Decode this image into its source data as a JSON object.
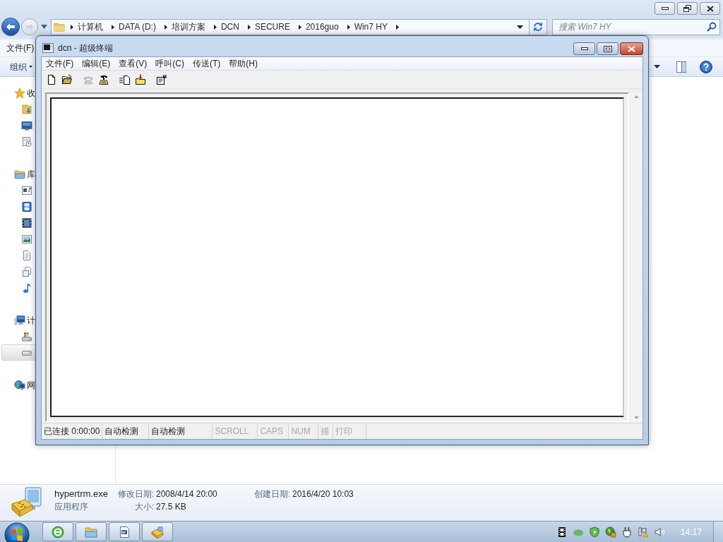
{
  "explorer": {
    "breadcrumbs": [
      "计算机",
      "DATA (D:)",
      "培训方案",
      "DCN",
      "SECURE",
      "2016guo",
      "Win7 HY"
    ],
    "search": {
      "placeholder": "搜索 Win7 HY"
    },
    "menu": [
      "文件(F)"
    ],
    "toolbar": {
      "organize": "组织"
    },
    "nav": [
      {
        "kind": "favorites",
        "label": "收",
        "children": [
          {
            "kind": "downloads",
            "selected": false
          },
          {
            "kind": "desktop",
            "selected": false
          },
          {
            "kind": "recent",
            "selected": false
          }
        ]
      },
      {
        "kind": "libraries",
        "label": "库",
        "children": [
          {
            "kind": "window",
            "selected": false
          },
          {
            "kind": "filmstrip",
            "selected": false
          },
          {
            "kind": "video",
            "selected": false
          },
          {
            "kind": "pictures",
            "selected": false
          },
          {
            "kind": "documents",
            "selected": false
          },
          {
            "kind": "pages",
            "selected": false
          },
          {
            "kind": "music",
            "selected": false
          }
        ]
      },
      {
        "kind": "computer",
        "label": "计",
        "children": [
          {
            "kind": "system-drive",
            "selected": false
          },
          {
            "kind": "drive",
            "selected": true
          }
        ]
      },
      {
        "kind": "network",
        "label": "网"
      }
    ],
    "details": {
      "name": "hypertrm.exe",
      "type": "应用程序",
      "properties": [
        {
          "label": "修改日期:",
          "value": "2008/4/14 20:00"
        },
        {
          "label": "创建日期:",
          "value": "2016/4/20 10:03"
        },
        {
          "label": "大小:",
          "value": "27.5 KB"
        }
      ]
    }
  },
  "terminal_window": {
    "title": "dcn - 超级终端",
    "menu": [
      "文件(F)",
      "编辑(E)",
      "查看(V)",
      "呼叫(C)",
      "传送(T)",
      "帮助(H)"
    ],
    "toolbar": [
      [
        {
          "kind": "new",
          "disabled": false
        },
        {
          "kind": "open",
          "disabled": false
        }
      ],
      [
        {
          "kind": "call",
          "disabled": true
        },
        {
          "kind": "disconnect",
          "disabled": false
        }
      ],
      [
        {
          "kind": "send",
          "disabled": false
        },
        {
          "kind": "receive",
          "disabled": false
        }
      ],
      [
        {
          "kind": "properties",
          "disabled": false
        }
      ]
    ],
    "status_bar": [
      {
        "text": "已连接 0:00:00",
        "enabled": true
      },
      {
        "text": "自动检测",
        "enabled": true
      },
      {
        "text": "自动检测",
        "enabled": true
      },
      {
        "text": "SCROLL",
        "enabled": false
      },
      {
        "text": "CAPS",
        "enabled": false
      },
      {
        "text": "NUM",
        "enabled": false
      },
      {
        "text": "捕",
        "enabled": false
      },
      {
        "text": "打印",
        "enabled": false
      }
    ]
  },
  "taskbar": {
    "clock": "14:17"
  }
}
